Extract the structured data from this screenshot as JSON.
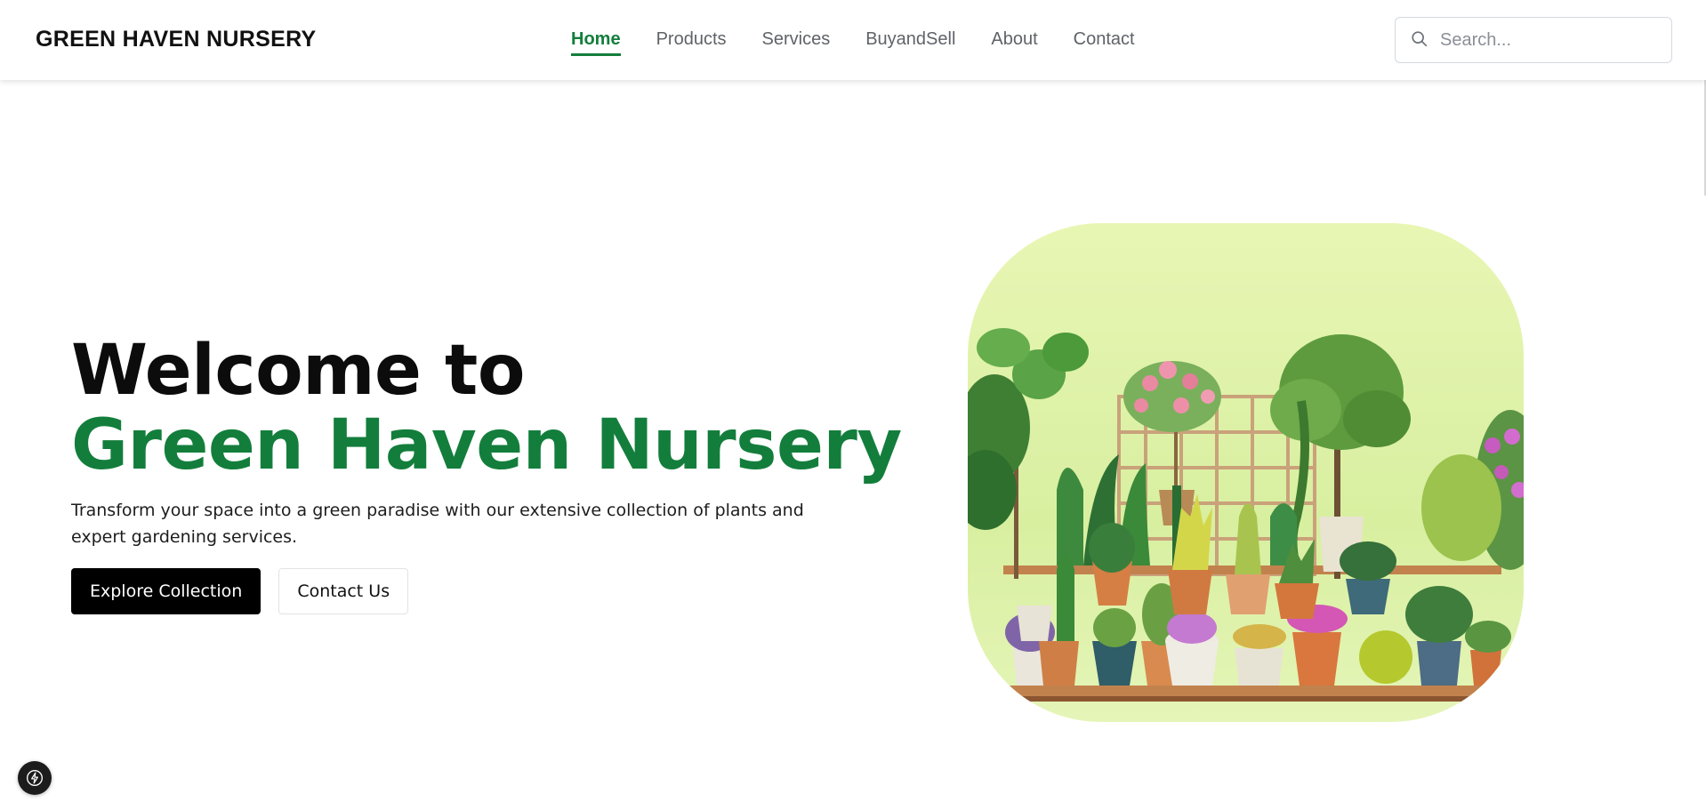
{
  "brand": {
    "name": "GREEN HAVEN NURSERY"
  },
  "nav": {
    "items": [
      {
        "label": "Home",
        "active": true
      },
      {
        "label": "Products",
        "active": false
      },
      {
        "label": "Services",
        "active": false
      },
      {
        "label": "BuyandSell",
        "active": false
      },
      {
        "label": "About",
        "active": false
      },
      {
        "label": "Contact",
        "active": false
      }
    ]
  },
  "search": {
    "placeholder": "Search...",
    "icon": "search-icon"
  },
  "hero": {
    "title_line1": "Welcome to",
    "title_line2": "Green Haven Nursery",
    "description": "Transform your space into a green paradise with our extensive collection of plants and expert gardening services.",
    "primary_cta": "Explore Collection",
    "secondary_cta": "Contact Us",
    "image_icon": "plant-collection-image"
  },
  "fab": {
    "icon": "lightning-icon"
  },
  "colors": {
    "accent": "#137e3c",
    "primary_button": "#000000",
    "image_bg": "#e3f3b0"
  }
}
